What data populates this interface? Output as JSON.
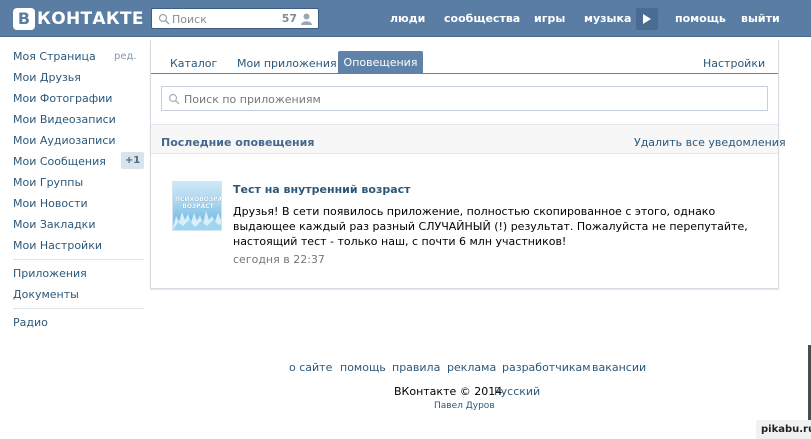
{
  "header": {
    "logo_letter": "В",
    "logo_text": "КОНТАКТЕ",
    "search_placeholder": "Поиск",
    "search_count": "57",
    "nav": {
      "people": "люди",
      "communities": "сообщества",
      "games": "игры",
      "music": "музыка",
      "help": "помощь",
      "logout": "выйти"
    }
  },
  "sidebar": {
    "edit_label": "ред.",
    "items": [
      {
        "label": "Моя Страница"
      },
      {
        "label": "Мои Друзья"
      },
      {
        "label": "Мои Фотографии"
      },
      {
        "label": "Мои Видеозаписи"
      },
      {
        "label": "Мои Аудиозаписи"
      },
      {
        "label": "Мои Сообщения"
      },
      {
        "label": "Мои Группы"
      },
      {
        "label": "Мои Новости"
      },
      {
        "label": "Мои Закладки"
      },
      {
        "label": "Мои Настройки"
      }
    ],
    "messages_badge": "+1",
    "extra": [
      {
        "label": "Приложения"
      },
      {
        "label": "Документы"
      }
    ],
    "radio": "Радио"
  },
  "tabs": {
    "catalog": "Каталог",
    "my_apps": "Мои приложения",
    "notifications": "Оповещения",
    "settings": "Настройки"
  },
  "app_search_placeholder": "Поиск по приложениям",
  "notifications": {
    "header": "Последние оповещения",
    "delete_all": "Удалить все уведомления",
    "item": {
      "thumb_text": "ПСИХОВОЗРАСТНЫЙ ВОЗРАСТ",
      "title": "Тест на внутренний возраст",
      "text": "Друзья! В сети появилось приложение, полностью скопированное с этого, однако выдающее каждый раз разный СЛУЧАЙНЫЙ (!) результат. Пожалуйста не перепутайте, настоящий тест - только наш, с почти 6 млн участников!",
      "time": "сегодня в 22:37"
    }
  },
  "footer": {
    "links": [
      "о сайте",
      "помощь",
      "правила",
      "реклама",
      "разработчикам",
      "вакансии"
    ],
    "copyright": "ВКонтакте © 2014",
    "language": "Русский",
    "author": "Павел Дуров"
  },
  "watermark": "pikabu.ru",
  "colors": {
    "header": "#597da3",
    "link": "#2b587a",
    "tab_active": "#5e82a8"
  }
}
